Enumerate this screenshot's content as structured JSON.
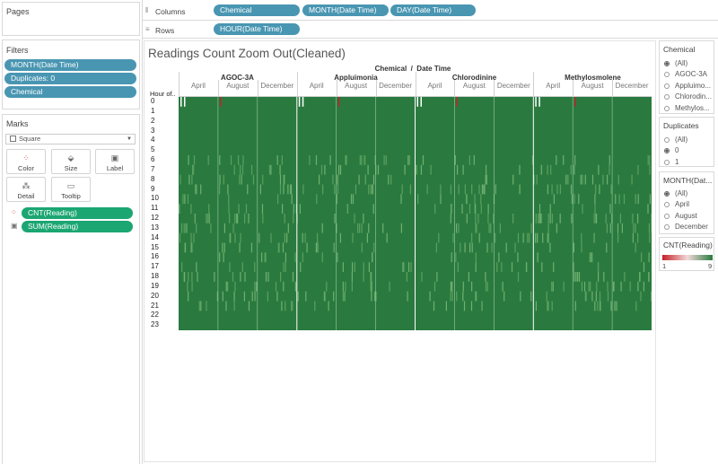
{
  "left": {
    "pages_title": "Pages",
    "filters_title": "Filters",
    "filters": [
      "MONTH(Date Time)",
      "Duplicates: 0",
      "Chemical"
    ],
    "marks_title": "Marks",
    "mark_type": "Square",
    "mark_buttons": [
      {
        "label": "Color",
        "icon": "color-icon"
      },
      {
        "label": "Size",
        "icon": "size-icon"
      },
      {
        "label": "Label",
        "icon": "label-icon"
      },
      {
        "label": "Detail",
        "icon": "detail-icon"
      },
      {
        "label": "Tooltip",
        "icon": "tooltip-icon"
      }
    ],
    "mark_fields": [
      "CNT(Reading)",
      "SUM(Reading)"
    ]
  },
  "shelves": {
    "columns_label": "Columns",
    "columns_pills": [
      "Chemical",
      "MONTH(Date Time)",
      "DAY(Date Time)"
    ],
    "rows_label": "Rows",
    "rows_pills": [
      "HOUR(Date Time)"
    ]
  },
  "viz": {
    "title": "Readings Count Zoom Out(Cleaned)",
    "column_header": "Chemical  /  Date Time",
    "row_header": "Hour of..",
    "chemicals": [
      "AGOC-3A",
      "Appluimonia",
      "Chlorodinine",
      "Methylosmolene"
    ],
    "months": [
      "April",
      "August",
      "December"
    ],
    "hours": [
      "0",
      "1",
      "2",
      "3",
      "4",
      "5",
      "6",
      "7",
      "8",
      "9",
      "10",
      "11",
      "12",
      "13",
      "14",
      "15",
      "16",
      "17",
      "18",
      "19",
      "20",
      "21",
      "22",
      "23"
    ]
  },
  "right": {
    "chemical_title": "Chemical",
    "chemical_options": [
      "(All)",
      "AGOC-3A",
      "Appluimo...",
      "Chlorodin...",
      "Methylos..."
    ],
    "chemical_selected": 0,
    "duplicates_title": "Duplicates",
    "duplicates_options": [
      "(All)",
      "0",
      "1"
    ],
    "duplicates_selected": 1,
    "month_title": "MONTH(Dat...",
    "month_options": [
      "(All)",
      "April",
      "August",
      "December"
    ],
    "month_selected": 0,
    "legend_title": "CNT(Reading)",
    "legend_min": "1",
    "legend_max": "9",
    "legend_colors": [
      "#c42127",
      "#f2d9d9",
      "#2a7a3f"
    ]
  },
  "chart_data": {
    "type": "heatmap",
    "title": "Readings Count Zoom Out(Cleaned)",
    "x_dimensions": [
      "Chemical",
      "MONTH(Date Time)",
      "DAY(Date Time)"
    ],
    "y_dimension": "HOUR(Date Time)",
    "chemicals": [
      "AGOC-3A",
      "Appluimonia",
      "Chlorodinine",
      "Methylosmolene"
    ],
    "months": [
      "April",
      "August",
      "December"
    ],
    "hours": [
      0,
      1,
      2,
      3,
      4,
      5,
      6,
      7,
      8,
      9,
      10,
      11,
      12,
      13,
      14,
      15,
      16,
      17,
      18,
      19,
      20,
      21,
      22,
      23
    ],
    "color_measure": "CNT(Reading)",
    "color_range": [
      1,
      9
    ],
    "dominant_value": 9
  }
}
